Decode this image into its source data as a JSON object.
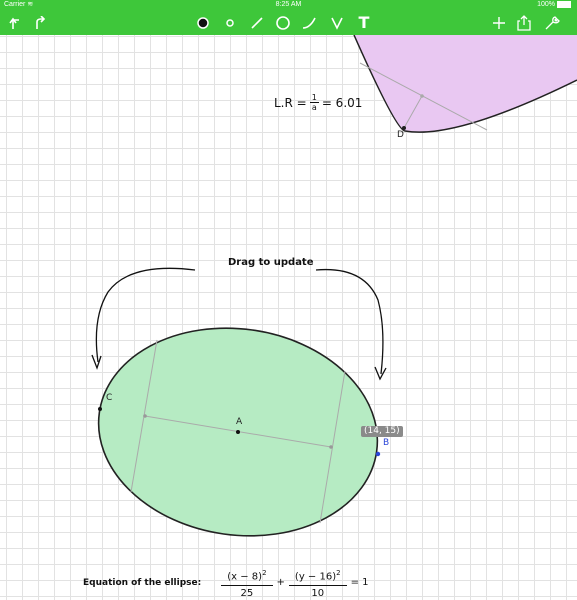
{
  "status_bar": {
    "carrier": "Carrier",
    "time": "8:25 AM",
    "battery": "100%"
  },
  "toolbar": {
    "color": "#3ec73a",
    "text_tool": "T",
    "tools": [
      "undo-icon",
      "redo-icon",
      "point-large-icon",
      "point-small-icon",
      "line-icon",
      "circle-icon",
      "curve-icon",
      "angle-icon",
      "text-tool",
      "add-icon",
      "share-icon",
      "settings-wrench-icon"
    ]
  },
  "canvas": {
    "latus_rectum": {
      "prefix": "L.R =",
      "num": "1",
      "den": "a",
      "suffix": "= 6.01"
    },
    "point_labels": {
      "d": "D",
      "c": "C",
      "a": "A",
      "b": "B"
    },
    "drag_hint": "Drag to update",
    "coord_tag": "(14, 15)",
    "equation": {
      "label": "Equation of the ellipse:",
      "term1_num": "(x − 8)",
      "term1_exp": "2",
      "term1_den": "25",
      "plus": "+",
      "term2_num": "(y − 16)",
      "term2_exp": "2",
      "term2_den": "10",
      "rhs": "= 1"
    },
    "colors": {
      "parabola_fill": "#e9c8f2",
      "ellipse_fill": "#b6ebc3",
      "point_b": "#2a45d8"
    }
  }
}
